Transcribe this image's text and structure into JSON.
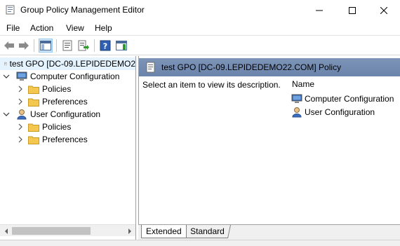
{
  "window": {
    "title": "Group Policy Management Editor",
    "minimize_icon": "minimize-icon",
    "maximize_icon": "maximize-icon",
    "close_icon": "close-icon"
  },
  "menu": [
    "File",
    "Action",
    "View",
    "Help"
  ],
  "toolbar": {
    "buttons": [
      "back-arrow-icon",
      "forward-arrow-icon",
      "show-hide-console-tree-icon",
      "properties-icon",
      "export-list-icon",
      "help-icon",
      "show-hide-action-pane-icon"
    ]
  },
  "tree": {
    "root": "test GPO [DC-09.LEPIDEDEMO2",
    "computer_config": {
      "label": "Computer Configuration",
      "children": [
        "Policies",
        "Preferences"
      ]
    },
    "user_config": {
      "label": "User Configuration",
      "children": [
        "Policies",
        "Preferences"
      ]
    }
  },
  "content": {
    "header": "test GPO [DC-09.LEPIDEDEMO22.COM] Policy",
    "description": "Select an item to view its description.",
    "column_name": "Name",
    "items": [
      "Computer Configuration",
      "User Configuration"
    ]
  },
  "tabs": [
    "Extended",
    "Standard"
  ],
  "colors": {
    "header_bg": "#6f87ad",
    "selection_bg": "#e5f3ff",
    "folder": "#f4c84f"
  }
}
